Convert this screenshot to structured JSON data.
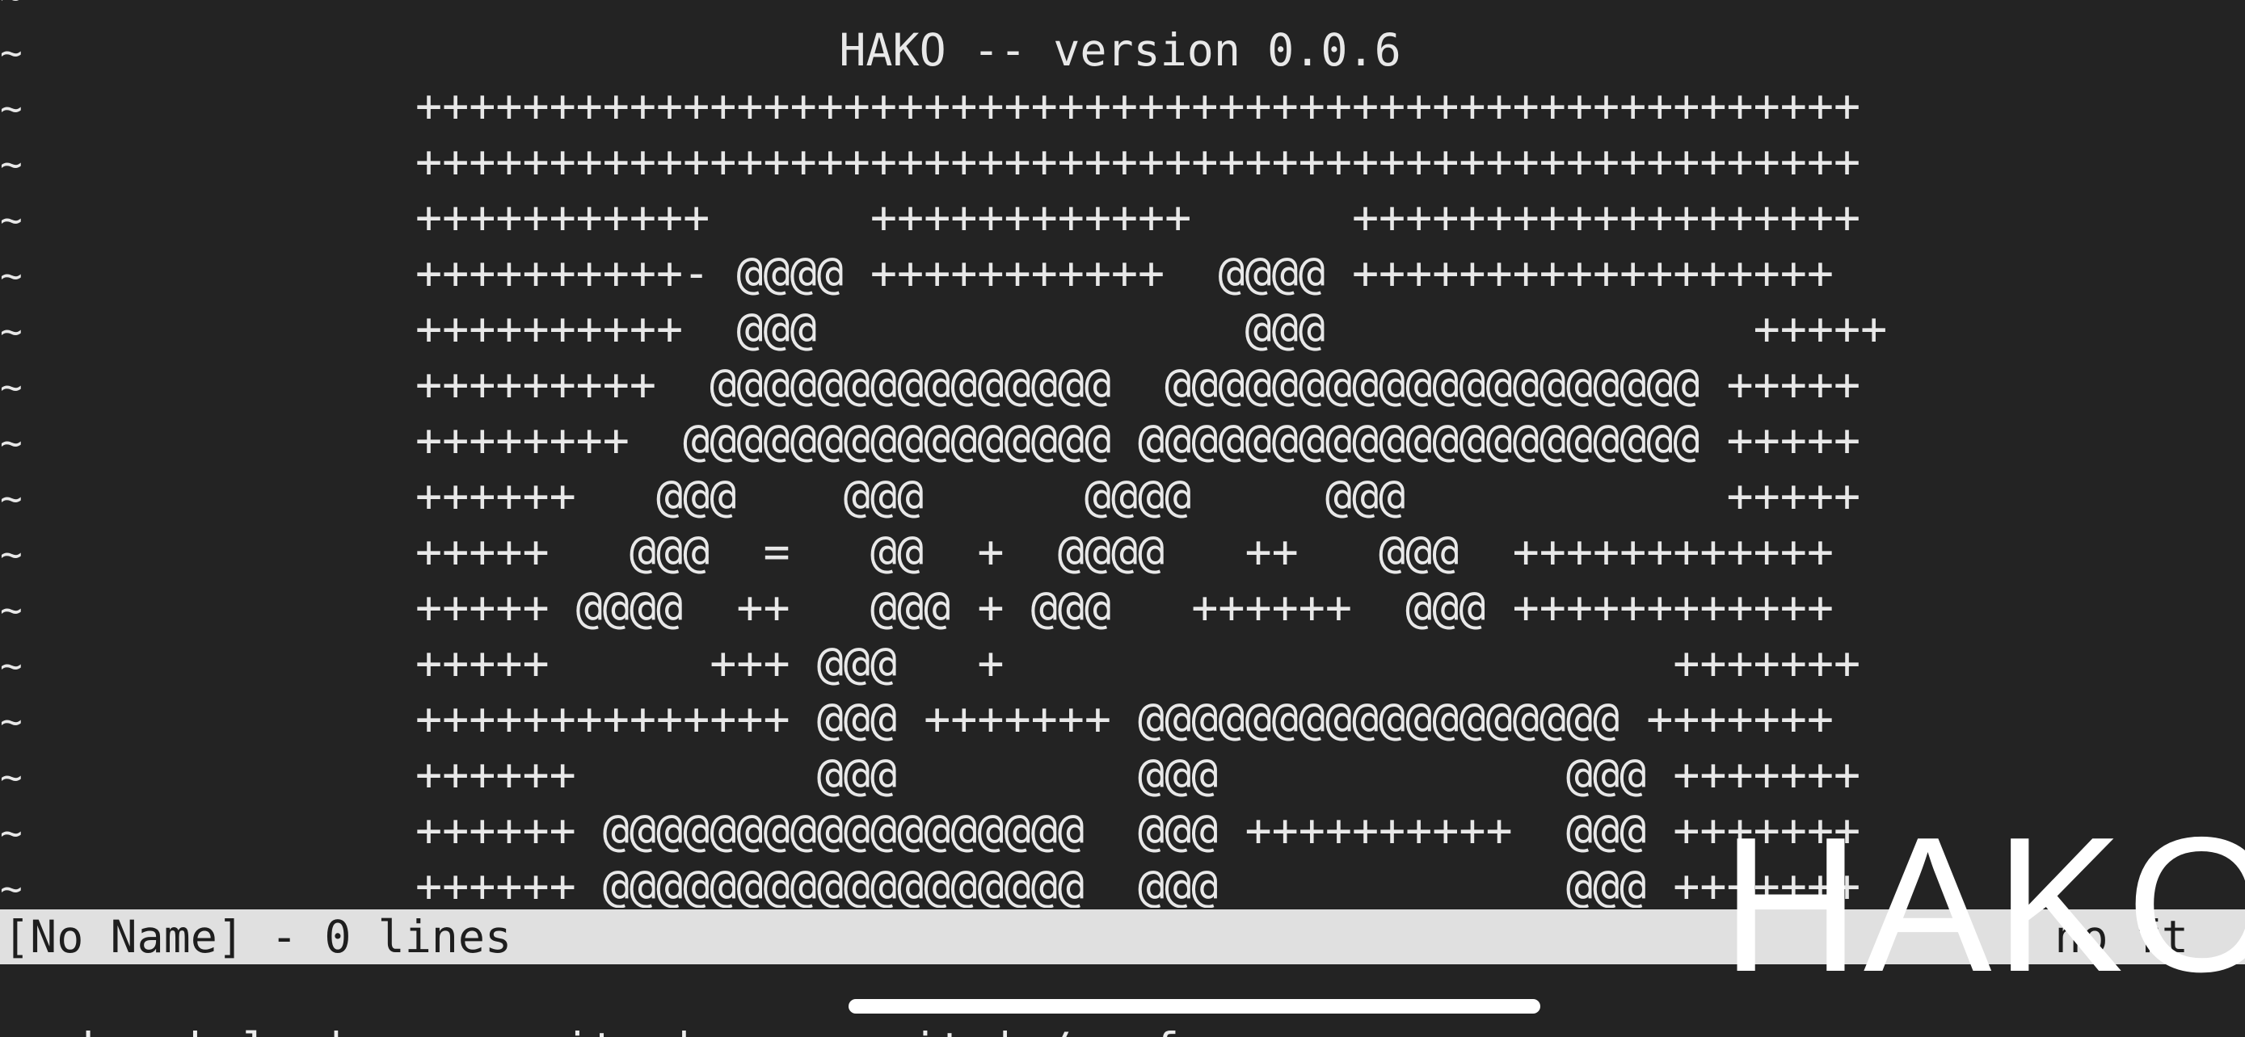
{
  "editor": {
    "empty_line_marker": "~",
    "title": "HAKO -- version 0.0.6",
    "art_lines": [
      "++++++++++++++++++++++++++++++++++++++++++++++++++++++",
      "++++++++++++++++++++++++++++++++++++++++++++++++++++++",
      "+++++++++++      ++++++++++++      +++++++++++++++++++",
      "++++++++++- @@@@ +++++++++++  @@@@ ++++++++++++++++++",
      "++++++++++  @@@                @@@                +++++",
      "+++++++++  @@@@@@@@@@@@@@@  @@@@@@@@@@@@@@@@@@@@ +++++",
      "++++++++  @@@@@@@@@@@@@@@@ @@@@@@@@@@@@@@@@@@@@@ +++++",
      "++++++   @@@    @@@      @@@@     @@@            +++++",
      "+++++   @@@  =   @@  +  @@@@   ++   @@@  ++++++++++++",
      "+++++ @@@@  ++   @@@ + @@@   ++++++  @@@ ++++++++++++",
      "+++++      +++ @@@   +                         +++++++",
      "++++++++++++++ @@@ +++++++ @@@@@@@@@@@@@@@@@@ +++++++",
      "++++++         @@@         @@@             @@@ +++++++",
      "++++++ @@@@@@@@@@@@@@@@@@  @@@ ++++++++++  @@@ +++++++",
      "++++++ @@@@@@@@@@@@@@@@@@  @@@             @@@ +++++++"
    ]
  },
  "statusline": {
    "left": "[No Name] - 0 lines",
    "right": "no ft"
  },
  "cmdline": {
    "hint": ":h = help | :w = write | :q = quit | / = fuzz"
  },
  "overlay": {
    "logo_text": "HAKO"
  }
}
